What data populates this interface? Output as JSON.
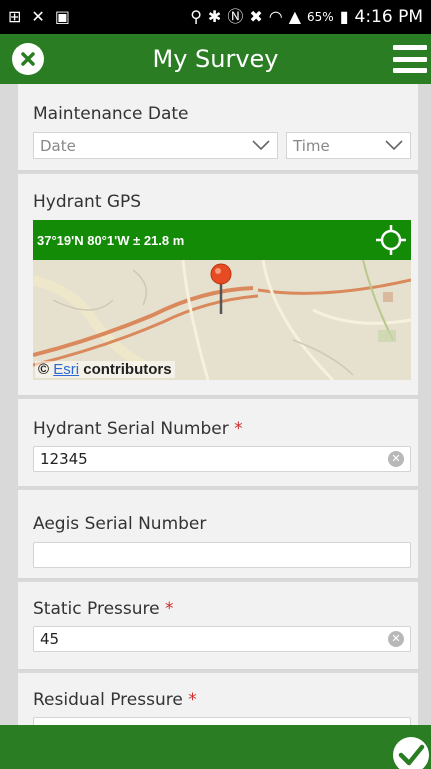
{
  "status_bar": {
    "battery": "65%",
    "time": "4:16 PM"
  },
  "app": {
    "title": "My Survey"
  },
  "form": {
    "maintenance_date": {
      "label": "Maintenance Date",
      "date_placeholder": "Date",
      "time_placeholder": "Time"
    },
    "hydrant_gps": {
      "label": "Hydrant GPS",
      "coordinates": "37°19'N 80°1'W ± 21.8 m",
      "attribution_prefix": "©",
      "attribution_link": "Esri",
      "attribution_suffix": "contributors"
    },
    "hydrant_serial": {
      "label": "Hydrant Serial Number",
      "required": "*",
      "value": "12345"
    },
    "aegis_serial": {
      "label": "Aegis Serial Number",
      "value": ""
    },
    "static_pressure": {
      "label": "Static Pressure",
      "required": "*",
      "value": "45"
    },
    "residual_pressure": {
      "label": "Residual Pressure",
      "required": "*",
      "value": ""
    }
  },
  "colors": {
    "brand_green": "#2a7d23",
    "gps_green": "#138b06",
    "required_red": "#d02b2b"
  },
  "icons": {
    "close": "close-icon",
    "menu": "hamburger-menu-icon",
    "locate": "crosshair-icon",
    "pin": "map-pin-icon",
    "clear": "clear-icon",
    "submit": "checkmark-icon"
  }
}
